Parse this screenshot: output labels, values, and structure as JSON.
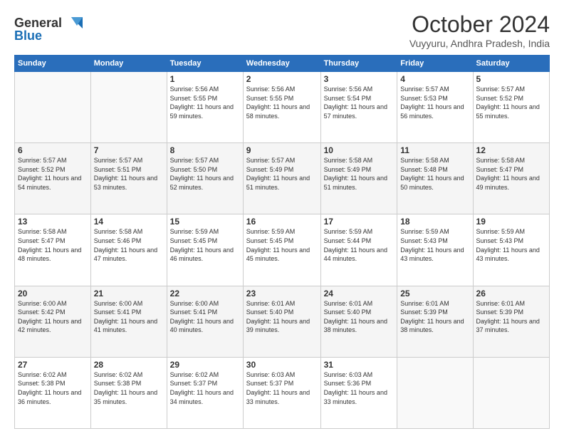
{
  "logo": {
    "line1": "General",
    "line2": "Blue"
  },
  "title": "October 2024",
  "location": "Vuyyuru, Andhra Pradesh, India",
  "days_of_week": [
    "Sunday",
    "Monday",
    "Tuesday",
    "Wednesday",
    "Thursday",
    "Friday",
    "Saturday"
  ],
  "weeks": [
    [
      {
        "day": "",
        "info": ""
      },
      {
        "day": "",
        "info": ""
      },
      {
        "day": "1",
        "info": "Sunrise: 5:56 AM\nSunset: 5:55 PM\nDaylight: 11 hours and 59 minutes."
      },
      {
        "day": "2",
        "info": "Sunrise: 5:56 AM\nSunset: 5:55 PM\nDaylight: 11 hours and 58 minutes."
      },
      {
        "day": "3",
        "info": "Sunrise: 5:56 AM\nSunset: 5:54 PM\nDaylight: 11 hours and 57 minutes."
      },
      {
        "day": "4",
        "info": "Sunrise: 5:57 AM\nSunset: 5:53 PM\nDaylight: 11 hours and 56 minutes."
      },
      {
        "day": "5",
        "info": "Sunrise: 5:57 AM\nSunset: 5:52 PM\nDaylight: 11 hours and 55 minutes."
      }
    ],
    [
      {
        "day": "6",
        "info": "Sunrise: 5:57 AM\nSunset: 5:52 PM\nDaylight: 11 hours and 54 minutes."
      },
      {
        "day": "7",
        "info": "Sunrise: 5:57 AM\nSunset: 5:51 PM\nDaylight: 11 hours and 53 minutes."
      },
      {
        "day": "8",
        "info": "Sunrise: 5:57 AM\nSunset: 5:50 PM\nDaylight: 11 hours and 52 minutes."
      },
      {
        "day": "9",
        "info": "Sunrise: 5:57 AM\nSunset: 5:49 PM\nDaylight: 11 hours and 51 minutes."
      },
      {
        "day": "10",
        "info": "Sunrise: 5:58 AM\nSunset: 5:49 PM\nDaylight: 11 hours and 51 minutes."
      },
      {
        "day": "11",
        "info": "Sunrise: 5:58 AM\nSunset: 5:48 PM\nDaylight: 11 hours and 50 minutes."
      },
      {
        "day": "12",
        "info": "Sunrise: 5:58 AM\nSunset: 5:47 PM\nDaylight: 11 hours and 49 minutes."
      }
    ],
    [
      {
        "day": "13",
        "info": "Sunrise: 5:58 AM\nSunset: 5:47 PM\nDaylight: 11 hours and 48 minutes."
      },
      {
        "day": "14",
        "info": "Sunrise: 5:58 AM\nSunset: 5:46 PM\nDaylight: 11 hours and 47 minutes."
      },
      {
        "day": "15",
        "info": "Sunrise: 5:59 AM\nSunset: 5:45 PM\nDaylight: 11 hours and 46 minutes."
      },
      {
        "day": "16",
        "info": "Sunrise: 5:59 AM\nSunset: 5:45 PM\nDaylight: 11 hours and 45 minutes."
      },
      {
        "day": "17",
        "info": "Sunrise: 5:59 AM\nSunset: 5:44 PM\nDaylight: 11 hours and 44 minutes."
      },
      {
        "day": "18",
        "info": "Sunrise: 5:59 AM\nSunset: 5:43 PM\nDaylight: 11 hours and 43 minutes."
      },
      {
        "day": "19",
        "info": "Sunrise: 5:59 AM\nSunset: 5:43 PM\nDaylight: 11 hours and 43 minutes."
      }
    ],
    [
      {
        "day": "20",
        "info": "Sunrise: 6:00 AM\nSunset: 5:42 PM\nDaylight: 11 hours and 42 minutes."
      },
      {
        "day": "21",
        "info": "Sunrise: 6:00 AM\nSunset: 5:41 PM\nDaylight: 11 hours and 41 minutes."
      },
      {
        "day": "22",
        "info": "Sunrise: 6:00 AM\nSunset: 5:41 PM\nDaylight: 11 hours and 40 minutes."
      },
      {
        "day": "23",
        "info": "Sunrise: 6:01 AM\nSunset: 5:40 PM\nDaylight: 11 hours and 39 minutes."
      },
      {
        "day": "24",
        "info": "Sunrise: 6:01 AM\nSunset: 5:40 PM\nDaylight: 11 hours and 38 minutes."
      },
      {
        "day": "25",
        "info": "Sunrise: 6:01 AM\nSunset: 5:39 PM\nDaylight: 11 hours and 38 minutes."
      },
      {
        "day": "26",
        "info": "Sunrise: 6:01 AM\nSunset: 5:39 PM\nDaylight: 11 hours and 37 minutes."
      }
    ],
    [
      {
        "day": "27",
        "info": "Sunrise: 6:02 AM\nSunset: 5:38 PM\nDaylight: 11 hours and 36 minutes."
      },
      {
        "day": "28",
        "info": "Sunrise: 6:02 AM\nSunset: 5:38 PM\nDaylight: 11 hours and 35 minutes."
      },
      {
        "day": "29",
        "info": "Sunrise: 6:02 AM\nSunset: 5:37 PM\nDaylight: 11 hours and 34 minutes."
      },
      {
        "day": "30",
        "info": "Sunrise: 6:03 AM\nSunset: 5:37 PM\nDaylight: 11 hours and 33 minutes."
      },
      {
        "day": "31",
        "info": "Sunrise: 6:03 AM\nSunset: 5:36 PM\nDaylight: 11 hours and 33 minutes."
      },
      {
        "day": "",
        "info": ""
      },
      {
        "day": "",
        "info": ""
      }
    ]
  ]
}
